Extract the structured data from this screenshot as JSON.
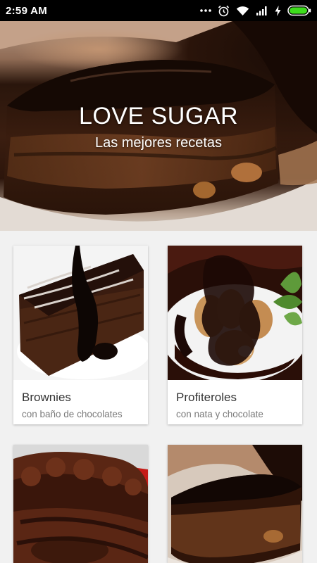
{
  "status_bar": {
    "time": "2:59 AM",
    "icons": [
      "more-dots-icon",
      "alarm-icon",
      "wifi-icon",
      "signal-icon",
      "charging-icon",
      "battery-icon"
    ]
  },
  "hero": {
    "title": "LOVE SUGAR",
    "subtitle": "Las mejores recetas"
  },
  "recipes": [
    {
      "title": "Brownies",
      "subtitle": "con baño de chocolates"
    },
    {
      "title": "Profiteroles",
      "subtitle": "con nata y chocolate"
    }
  ],
  "colors": {
    "background": "#f1f1f1",
    "card": "#ffffff",
    "battery": "#3ddc1c"
  }
}
